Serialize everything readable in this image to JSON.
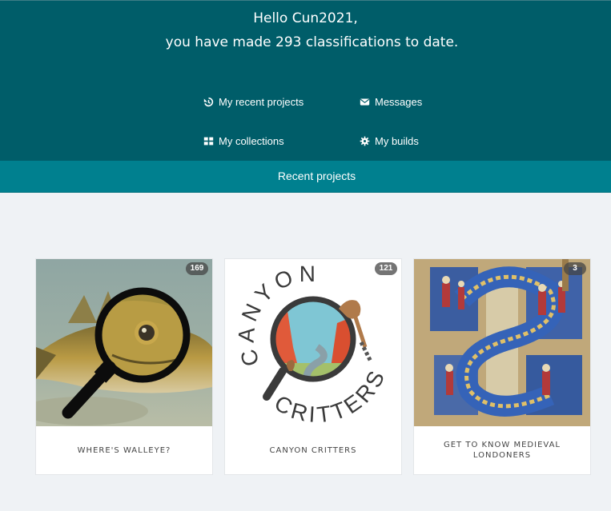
{
  "greeting": {
    "line1": "Hello Cun2021,",
    "line2": "you have made 293 classifications to date."
  },
  "nav": {
    "recent_projects": "My recent projects",
    "messages": "Messages",
    "collections": "My collections",
    "builds": "My builds"
  },
  "tabs": {
    "active_label": "Recent projects"
  },
  "projects": [
    {
      "title": "WHERE'S WALLEYE?",
      "count": "169"
    },
    {
      "title": "CANYON CRITTERS",
      "count": "121"
    },
    {
      "title": "GET TO KNOW MEDIEVAL LONDONERS",
      "count": "3"
    }
  ],
  "logo_text": {
    "canyon": "CANYON",
    "critters": "CRITTERS"
  },
  "colors": {
    "hero_bg": "#005d69",
    "tabbar_bg": "#00808f",
    "page_bg": "#eff2f5"
  },
  "icons": {
    "recent": "history-icon",
    "messages": "envelope-icon",
    "collections": "grid-icon",
    "builds": "gear-icon"
  }
}
